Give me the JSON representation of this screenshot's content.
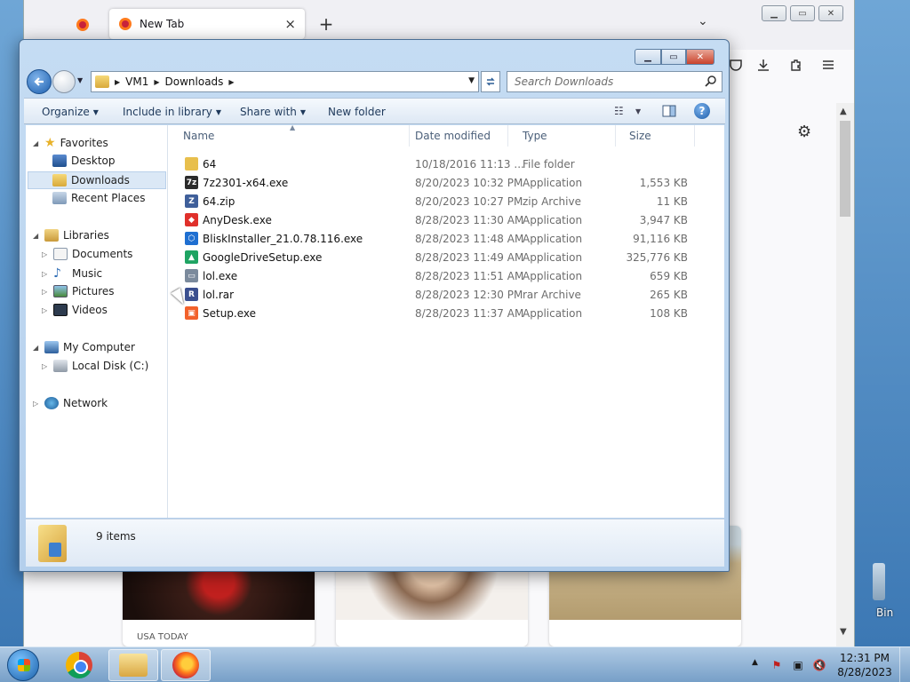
{
  "desktop": {
    "recycle_bin_label": "Bin"
  },
  "browser": {
    "tab_title": "New Tab",
    "tab_close": "×",
    "new_tab": "+",
    "list_tabs": "⌄",
    "toolbar_icons": [
      "pocket-icon",
      "download-icon",
      "extensions-icon",
      "menu-icon"
    ],
    "news_source": "USA TODAY"
  },
  "explorer": {
    "breadcrumbs": [
      "VM1",
      "Downloads"
    ],
    "search_placeholder": "Search Downloads",
    "commands": {
      "organize": "Organize",
      "include_in_library": "Include in library",
      "share_with": "Share with",
      "new_folder": "New folder"
    },
    "nav": {
      "favorites": "Favorites",
      "desktop": "Desktop",
      "downloads": "Downloads",
      "recent_places": "Recent Places",
      "libraries": "Libraries",
      "documents": "Documents",
      "music": "Music",
      "pictures": "Pictures",
      "videos": "Videos",
      "my_computer": "My Computer",
      "local_disk": "Local Disk (C:)",
      "network": "Network"
    },
    "columns": {
      "name": "Name",
      "date": "Date modified",
      "type": "Type",
      "size": "Size"
    },
    "files": [
      {
        "name": "64",
        "date": "10/18/2016 11:13 ...",
        "type": "File folder",
        "size": "",
        "icon": "folder-icon",
        "color": "#e8bf4d"
      },
      {
        "name": "7z2301-x64.exe",
        "date": "8/20/2023 10:32 PM",
        "type": "Application",
        "size": "1,553 KB",
        "icon": "7zip-icon",
        "color": "#2b2b2b"
      },
      {
        "name": "64.zip",
        "date": "8/20/2023 10:27 PM",
        "type": "zip Archive",
        "size": "11 KB",
        "icon": "zip-icon",
        "color": "#3f5f9a"
      },
      {
        "name": "AnyDesk.exe",
        "date": "8/28/2023 11:30 AM",
        "type": "Application",
        "size": "3,947 KB",
        "icon": "anydesk-icon",
        "color": "#e0302b"
      },
      {
        "name": "BliskInstaller_21.0.78.116.exe",
        "date": "8/28/2023 11:48 AM",
        "type": "Application",
        "size": "91,116 KB",
        "icon": "blisk-icon",
        "color": "#1f6fd1"
      },
      {
        "name": "GoogleDriveSetup.exe",
        "date": "8/28/2023 11:49 AM",
        "type": "Application",
        "size": "325,776 KB",
        "icon": "google-drive-icon",
        "color": "#1fa463"
      },
      {
        "name": "lol.exe",
        "date": "8/28/2023 11:51 AM",
        "type": "Application",
        "size": "659 KB",
        "icon": "exe-icon",
        "color": "#7b8a9c"
      },
      {
        "name": "lol.rar",
        "date": "8/28/2023 12:30 PM",
        "type": "rar Archive",
        "size": "265 KB",
        "icon": "rar-icon",
        "color": "#3a4f8f"
      },
      {
        "name": "Setup.exe",
        "date": "8/28/2023 11:37 AM",
        "type": "Application",
        "size": "108 KB",
        "icon": "setup-icon",
        "color": "#f2612b"
      }
    ],
    "status": {
      "items_count": "9 items"
    }
  },
  "taskbar": {
    "apps": [
      "chrome-icon",
      "explorer-icon",
      "firefox-icon"
    ],
    "time": "12:31 PM",
    "date": "8/28/2023"
  }
}
